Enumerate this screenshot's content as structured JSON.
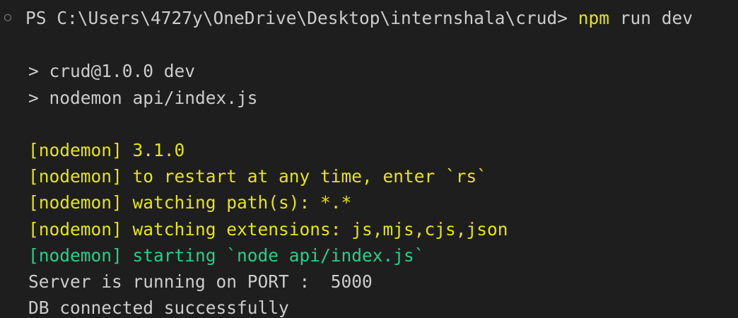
{
  "terminal": {
    "prompt": {
      "path": "PS C:\\Users\\4727y\\OneDrive\\Desktop\\internshala\\crud> ",
      "command": "npm",
      "args": " run dev"
    },
    "script_lines": [
      "> crud@1.0.0 dev",
      "> nodemon api/index.js"
    ],
    "nodemon_lines": [
      {
        "tag": "[nodemon]",
        "text": " 3.1.0",
        "color": "#e5e510"
      },
      {
        "tag": "[nodemon]",
        "text": " to restart at any time, enter `rs`",
        "color": "#e5e510"
      },
      {
        "tag": "[nodemon]",
        "text": " watching path(s): *.*",
        "color": "#e5e510"
      },
      {
        "tag": "[nodemon]",
        "text": " watching extensions: js,mjs,cjs,json",
        "color": "#e5e510"
      },
      {
        "tag": "[nodemon]",
        "text": " starting `node api/index.js`",
        "color": "#23d18b"
      }
    ],
    "output_lines": [
      "Server is running on PORT :  5000",
      "DB connected successfully"
    ],
    "colors": {
      "background": "#1e1e1e",
      "foreground": "#cccccc",
      "yellow": "#e5e510",
      "green": "#23d18b"
    }
  }
}
